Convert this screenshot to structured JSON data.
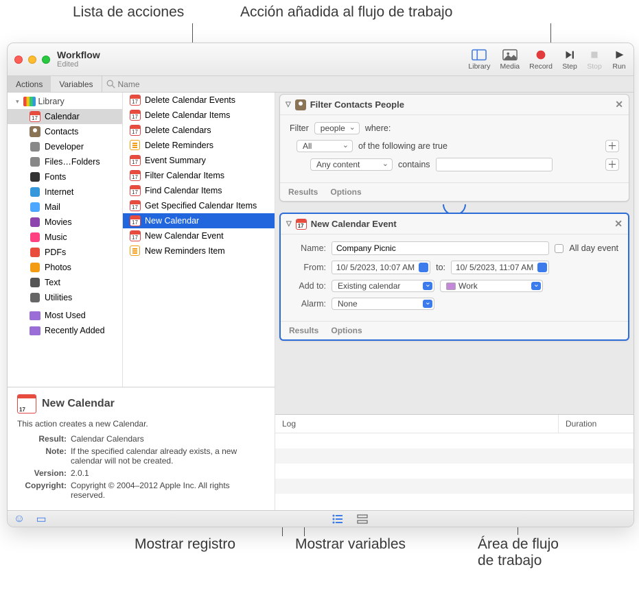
{
  "callouts": {
    "top_left": "Lista de acciones",
    "top_right": "Acción añadida al flujo de trabajo",
    "bottom_left": "Mostrar registro",
    "bottom_mid": "Mostrar variables",
    "bottom_right": "Área de flujo\nde trabajo"
  },
  "window": {
    "title": "Workflow",
    "subtitle": "Edited"
  },
  "toolbar": {
    "library": "Library",
    "media": "Media",
    "record": "Record",
    "step": "Step",
    "stop": "Stop",
    "run": "Run"
  },
  "tabs": {
    "actions": "Actions",
    "variables": "Variables",
    "search_placeholder": "Name"
  },
  "sidebar": {
    "header": "Library",
    "items": [
      "Calendar",
      "Contacts",
      "Developer",
      "Files…Folders",
      "Fonts",
      "Internet",
      "Mail",
      "Movies",
      "Music",
      "PDFs",
      "Photos",
      "Text",
      "Utilities"
    ],
    "extras": [
      "Most Used",
      "Recently Added"
    ],
    "selected_index": 0
  },
  "actions_list": {
    "items": [
      "Delete Calendar Events",
      "Delete Calendar Items",
      "Delete Calendars",
      "Delete Reminders",
      "Event Summary",
      "Filter Calendar Items",
      "Find Calendar Items",
      "Get Specified Calendar Items",
      "New Calendar",
      "New Calendar Event",
      "New Reminders Item"
    ],
    "selected_index": 8
  },
  "workflow": {
    "card1": {
      "title": "Filter Contacts People",
      "filter_label": "Filter",
      "filter_value": "people",
      "where": "where:",
      "all": "All",
      "of_following": "of the following are true",
      "any_content": "Any content",
      "contains": "contains",
      "results": "Results",
      "options": "Options"
    },
    "card2": {
      "title": "New Calendar Event",
      "name_label": "Name:",
      "name_value": "Company Picnic",
      "allday": "All day event",
      "from_label": "From:",
      "from_value": "10/ 5/2023, 10:07 AM",
      "to_label": "to:",
      "to_value": "10/ 5/2023, 11:07 AM",
      "addto_label": "Add to:",
      "addto_value": "Existing calendar",
      "addto_cal": "Work",
      "alarm_label": "Alarm:",
      "alarm_value": "None",
      "results": "Results",
      "options": "Options"
    }
  },
  "log": {
    "col1": "Log",
    "col2": "Duration"
  },
  "info": {
    "title": "New Calendar",
    "desc": "This action creates a new Calendar.",
    "result_k": "Result:",
    "result_v": "Calendar Calendars",
    "note_k": "Note:",
    "note_v": "If the specified calendar already exists, a new calendar will not be created.",
    "version_k": "Version:",
    "version_v": "2.0.1",
    "copyright_k": "Copyright:",
    "copyright_v": "Copyright © 2004–2012 Apple Inc.  All rights reserved."
  }
}
